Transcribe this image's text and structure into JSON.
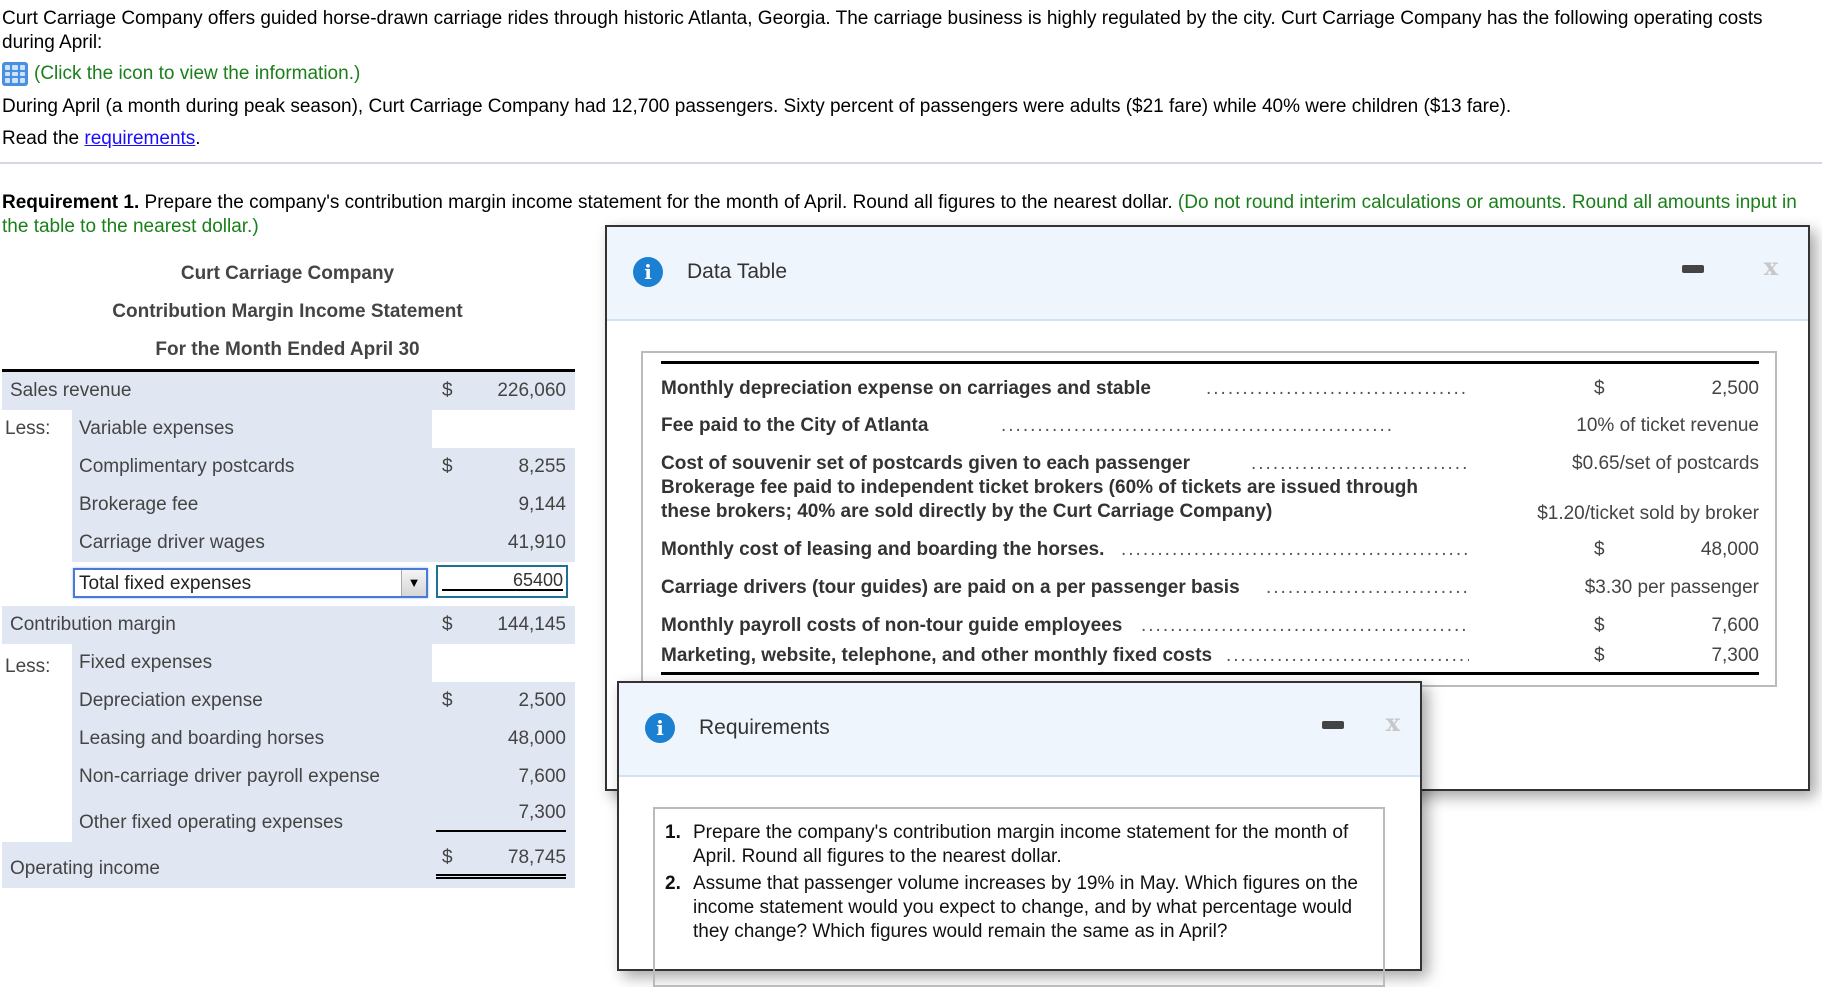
{
  "intro": {
    "paragraph": "Curt Carriage Company offers guided horse-drawn carriage rides through historic Atlanta, Georgia. The carriage business is highly regulated by the city. Curt Carriage Company has the following operating costs during April:",
    "icon_link": "(Click the icon to view the information.)",
    "icon": "data-grid-icon",
    "passengers": "During April (a month during peak season), Curt Carriage Company had 12,700 passengers. Sixty percent of passengers were adults ($21 fare) while 40% were children ($13 fare).",
    "read_prefix": "Read the ",
    "read_link": "requirements",
    "read_suffix": "."
  },
  "requirement1": {
    "label": "Requirement 1.",
    "text": " Prepare the company's contribution margin income statement for the month of April. Round all figures to the nearest dollar. ",
    "note": "(Do not round interim calculations or amounts. Round all amounts input in the table to the nearest dollar.)"
  },
  "statement": {
    "company": "Curt Carriage Company",
    "title": "Contribution Margin Income Statement",
    "period": "For the Month Ended April 30",
    "sales_revenue": {
      "label": "Sales revenue",
      "currency": "$",
      "amount": "226,060"
    },
    "less_label": "Less:",
    "variable_header": "Variable expenses",
    "variable_items": [
      {
        "label": "Complimentary postcards",
        "currency": "$",
        "amount": "8,255"
      },
      {
        "label": "Brokerage fee",
        "currency": "",
        "amount": "9,144"
      },
      {
        "label": "Carriage driver wages",
        "currency": "",
        "amount": "41,910"
      }
    ],
    "total_select": {
      "selected": "Total fixed expenses"
    },
    "total_input": {
      "value": "65400"
    },
    "contribution_margin": {
      "label": "Contribution margin",
      "currency": "$",
      "amount": "144,145"
    },
    "fixed_less_label": "Less:",
    "fixed_header": "Fixed expenses",
    "fixed_items": [
      {
        "label": "Depreciation expense",
        "currency": "$",
        "amount": "2,500"
      },
      {
        "label": "Leasing and boarding horses",
        "currency": "",
        "amount": "48,000"
      },
      {
        "label": "Non-carriage driver payroll expense",
        "currency": "",
        "amount": "7,600"
      },
      {
        "label": "Other fixed operating expenses",
        "currency": "",
        "amount": "7,300"
      }
    ],
    "operating_income": {
      "label": "Operating income",
      "currency": "$",
      "amount": "78,745"
    }
  },
  "data_table_popup": {
    "title": "Data Table",
    "rows": [
      {
        "label": "Monthly depreciation expense on carriages and stable",
        "currency": "$",
        "value": "2,500"
      },
      {
        "label": "Fee paid to the City of Atlanta",
        "currency": "",
        "value": "10% of ticket revenue"
      },
      {
        "label": "Cost of souvenir set of postcards given to each passenger",
        "currency": "",
        "value": "$0.65/set of postcards"
      },
      {
        "label": "Brokerage fee paid to independent ticket brokers (60% of tickets are issued through",
        "label2": "these brokers; 40% are sold directly by the Curt Carriage Company)",
        "currency": "",
        "value": "$1.20/ticket sold by broker"
      },
      {
        "label": "Monthly cost of leasing and boarding the horses.",
        "currency": "$",
        "value": "48,000"
      },
      {
        "label": "Carriage drivers (tour guides) are paid on a per passenger basis",
        "currency": "",
        "value": "$3.30 per passenger"
      },
      {
        "label": "Monthly payroll costs of non-tour guide employees",
        "currency": "$",
        "value": "7,600"
      },
      {
        "label": "Marketing, website, telephone, and other monthly fixed costs",
        "currency": "$",
        "value": "7,300"
      }
    ],
    "dots": "......................................................"
  },
  "requirements_popup": {
    "title": "Requirements",
    "items": [
      {
        "num": "1.",
        "text": "Prepare the company's contribution margin income statement for the month of April. Round all figures to the nearest dollar."
      },
      {
        "num": "2.",
        "text": "Assume that passenger volume increases by 19% in May. Which figures on the income statement would you expect to change, and by what percentage would they change? Which figures would remain the same as in April?"
      }
    ]
  },
  "icons": {
    "info": "i",
    "minimize": "minimize-icon",
    "close": "x",
    "dropdown": "▼"
  }
}
